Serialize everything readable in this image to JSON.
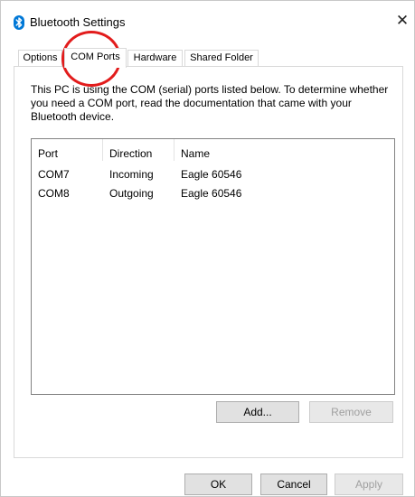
{
  "window": {
    "title": "Bluetooth Settings",
    "close_glyph": "✕"
  },
  "tabs": [
    {
      "label": "Options"
    },
    {
      "label": "COM Ports",
      "selected": true
    },
    {
      "label": "Hardware"
    },
    {
      "label": "Shared Folder"
    }
  ],
  "com_ports": {
    "description": "This PC is using the COM (serial) ports listed below. To determine whether you need a COM port, read the documentation that came with your Bluetooth device.",
    "columns": [
      "Port",
      "Direction",
      "Name"
    ],
    "rows": [
      {
        "port": "COM7",
        "direction": "Incoming",
        "name": "Eagle 60546"
      },
      {
        "port": "COM8",
        "direction": "Outgoing",
        "name": "Eagle 60546"
      }
    ],
    "add_label": "Add...",
    "remove_label": "Remove"
  },
  "footer": {
    "ok_label": "OK",
    "cancel_label": "Cancel",
    "apply_label": "Apply"
  },
  "annotation": {
    "color": "#e21c1c"
  },
  "colors": {
    "bluetooth_blue": "#0078d7"
  }
}
